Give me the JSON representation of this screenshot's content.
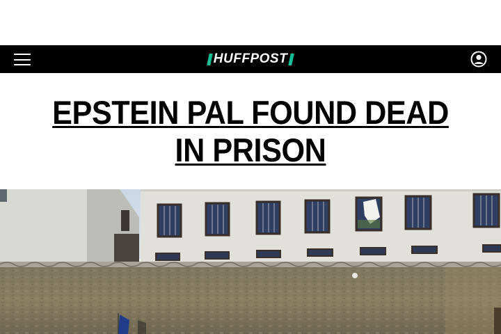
{
  "header": {
    "logo_text": "HUFFPOST",
    "menu_icon": "hamburger-menu-icon",
    "account_icon": "user-account-icon",
    "brand_accent": "#0dbe98",
    "background": "#000000"
  },
  "article": {
    "headline": "EPSTEIN PAL FOUND DEAD IN PRISON",
    "hero_image_alt": "prison-building-photo"
  }
}
